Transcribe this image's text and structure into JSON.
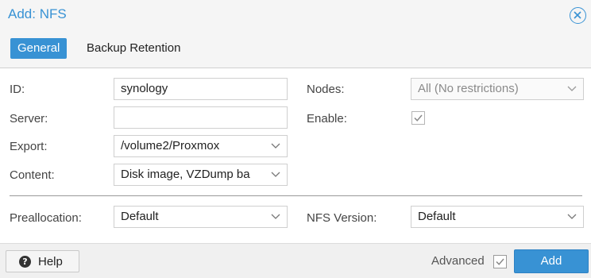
{
  "dialog": {
    "title": "Add: NFS",
    "close_icon": "close-circle-icon"
  },
  "tabs": [
    {
      "label": "General",
      "active": true
    },
    {
      "label": "Backup Retention",
      "active": false
    }
  ],
  "form": {
    "id": {
      "label": "ID:",
      "value": "synology"
    },
    "server": {
      "label": "Server:",
      "value": ""
    },
    "export": {
      "label": "Export:",
      "value": "/volume2/Proxmox"
    },
    "content": {
      "label": "Content:",
      "value": "Disk image, VZDump ba"
    },
    "nodes": {
      "label": "Nodes:",
      "value": "All (No restrictions)"
    },
    "enable": {
      "label": "Enable:",
      "checked": true
    },
    "preallocation": {
      "label": "Preallocation:",
      "value": "Default"
    },
    "nfs_version": {
      "label": "NFS Version:",
      "value": "Default"
    }
  },
  "footer": {
    "help_label": "Help",
    "help_icon": "question-circle-icon",
    "advanced_label": "Advanced",
    "advanced_checked": true,
    "add_label": "Add"
  },
  "colors": {
    "accent": "#3892d4",
    "panel_bg": "#ffffff",
    "chrome_bg": "#f5f5f5"
  }
}
